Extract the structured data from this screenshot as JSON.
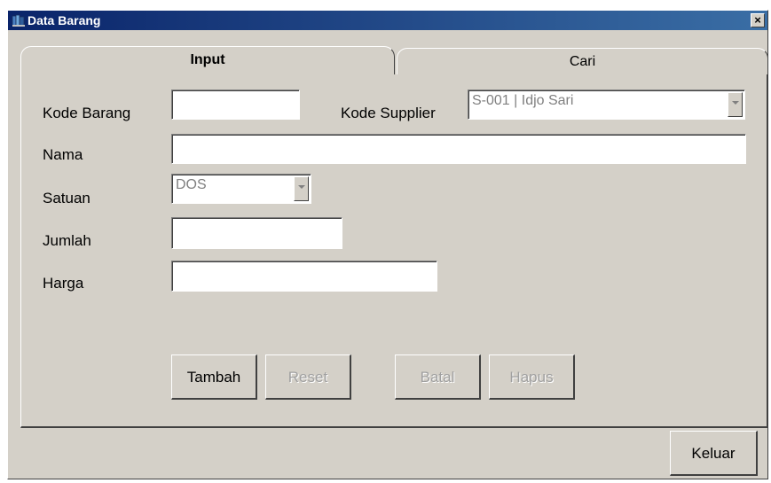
{
  "window": {
    "title": "Data Barang",
    "close_label": "×"
  },
  "tabs": [
    {
      "label": "Input",
      "active": true
    },
    {
      "label": "Cari",
      "active": false
    }
  ],
  "form": {
    "kode_barang": {
      "label": "Kode Barang",
      "value": ""
    },
    "kode_supplier": {
      "label": "Kode Supplier",
      "value": "S-001 | Idjo Sari"
    },
    "nama": {
      "label": "Nama",
      "value": ""
    },
    "satuan": {
      "label": "Satuan",
      "value": "DOS"
    },
    "jumlah": {
      "label": "Jumlah",
      "value": ""
    },
    "harga": {
      "label": "Harga",
      "value": ""
    }
  },
  "buttons": {
    "tambah": "Tambah",
    "reset": "Reset",
    "batal": "Batal",
    "hapus": "Hapus",
    "keluar": "Keluar"
  },
  "icons": {
    "window_icon": "books-icon",
    "dropdown": "chevron-down-icon"
  }
}
